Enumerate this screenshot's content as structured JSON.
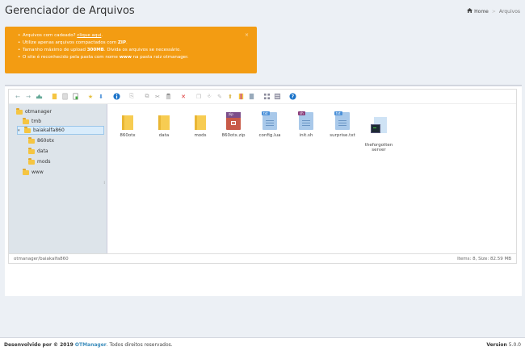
{
  "header": {
    "title": "Gerenciador de Arquivos"
  },
  "breadcrumb": {
    "home": "Home",
    "current": "Arquivos"
  },
  "alert": {
    "line1_prefix": "Arquivos com cadeado? ",
    "line1_link": "clique aqui",
    "line1_suffix": ".",
    "line2_prefix": "Utilize apenas arquivos compactados com ",
    "line2_bold": "ZIP",
    "line2_suffix": ".",
    "line3_prefix": "Tamanho máximo de upload ",
    "line3_bold": "300MB",
    "line3_suffix": ". Divida os arquivos se necessário.",
    "line4_prefix": "O site é reconhecido pela pasta com nome ",
    "line4_bold": "www",
    "line4_suffix": " na pasta raiz otmanager.",
    "close": "×"
  },
  "tree": {
    "items": [
      {
        "label": "otmanager"
      },
      {
        "label": "tmb"
      },
      {
        "label": "baiakalfa860"
      },
      {
        "label": "860otx"
      },
      {
        "label": "data"
      },
      {
        "label": "mods"
      },
      {
        "label": "www"
      }
    ]
  },
  "files": [
    {
      "name": "860otx",
      "type": "folder"
    },
    {
      "name": "data",
      "type": "folder"
    },
    {
      "name": "mods",
      "type": "folder"
    },
    {
      "name": "860otx.zip",
      "type": "zip",
      "tag": "zip"
    },
    {
      "name": "config.lua",
      "type": "doc",
      "tag": "txt"
    },
    {
      "name": "init.sh",
      "type": "doc",
      "tag": "sh"
    },
    {
      "name": "surprise.txt",
      "type": "doc",
      "tag": "txt"
    },
    {
      "name": "theforgotten\nserver",
      "type": "exe"
    }
  ],
  "status": {
    "path": "otmanager/baiakalfa860",
    "info": "Items: 8, Size: 82.59 MB"
  },
  "footer": {
    "left_prefix": "Desenvolvido por © 2019 ",
    "left_brand": "OTManager",
    "left_suffix": ". Todos direitos reservados.",
    "right_label": "Version",
    "right_value": "5.0.0"
  },
  "colors": {
    "alert": "#f39c12",
    "brand": "#3c8dbc",
    "tree_bg": "#dde4ea"
  }
}
